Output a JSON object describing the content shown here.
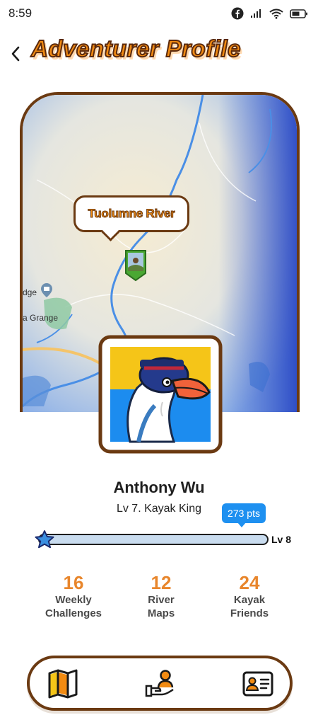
{
  "status_bar": {
    "time": "8:59"
  },
  "header": {
    "back_icon": "chevron-left-icon",
    "title": "Adventurer Profile"
  },
  "map": {
    "location_label": "Tuolumne River",
    "place_labels": [
      "dge",
      "a Grange"
    ],
    "colors": {
      "water": "#4a8fe6",
      "land": "#f4ead2",
      "border": "#6b3a12"
    }
  },
  "profile": {
    "name": "Anthony Wu",
    "level_title": "Lv 7. Kayak King",
    "points": "273 pts",
    "progress": 0.0,
    "next_level": "Lv 8"
  },
  "stats": [
    {
      "value": "16",
      "label_line1": "Weekly",
      "label_line2": "Challenges"
    },
    {
      "value": "12",
      "label_line1": "River",
      "label_line2": "Maps"
    },
    {
      "value": "24",
      "label_line1": "Kayak",
      "label_line2": "Friends"
    }
  ],
  "nav": {
    "items": [
      {
        "icon": "map-icon"
      },
      {
        "icon": "hand-person-icon"
      },
      {
        "icon": "id-card-icon"
      }
    ]
  },
  "colors": {
    "accent": "#f28b12",
    "brown": "#6b3a12",
    "blue": "#1e90f0",
    "stat": "#e8862c"
  }
}
